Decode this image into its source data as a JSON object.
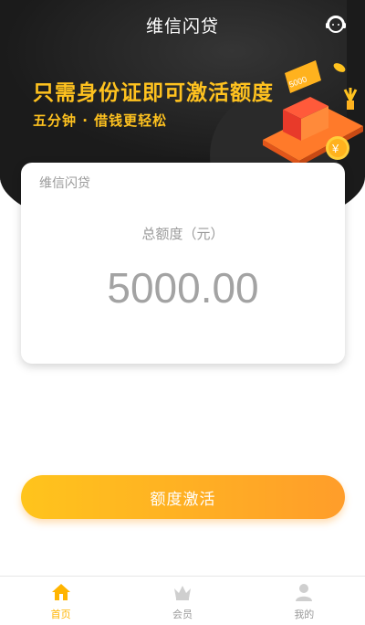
{
  "header": {
    "title": "维信闪贷",
    "service_icon": "customer-service-icon"
  },
  "banner": {
    "headline": "只需身份证即可激活额度",
    "subline": "五分钟 · 借钱更轻松",
    "illustration_note_label": "5000",
    "illustration_coin_symbol": "¥"
  },
  "card": {
    "brand": "维信闪贷",
    "label": "总额度（元）",
    "amount": "5000.00"
  },
  "action": {
    "label": "额度激活"
  },
  "tabs": [
    {
      "label": "首页",
      "icon": "home-icon",
      "active": true
    },
    {
      "label": "会员",
      "icon": "crown-icon",
      "active": false
    },
    {
      "label": "我的",
      "icon": "user-icon",
      "active": false
    }
  ],
  "colors": {
    "accent": "#ffb400",
    "hero_bg": "#1b1b1b",
    "button_start": "#ffc41c",
    "button_end": "#ff9d2a"
  }
}
